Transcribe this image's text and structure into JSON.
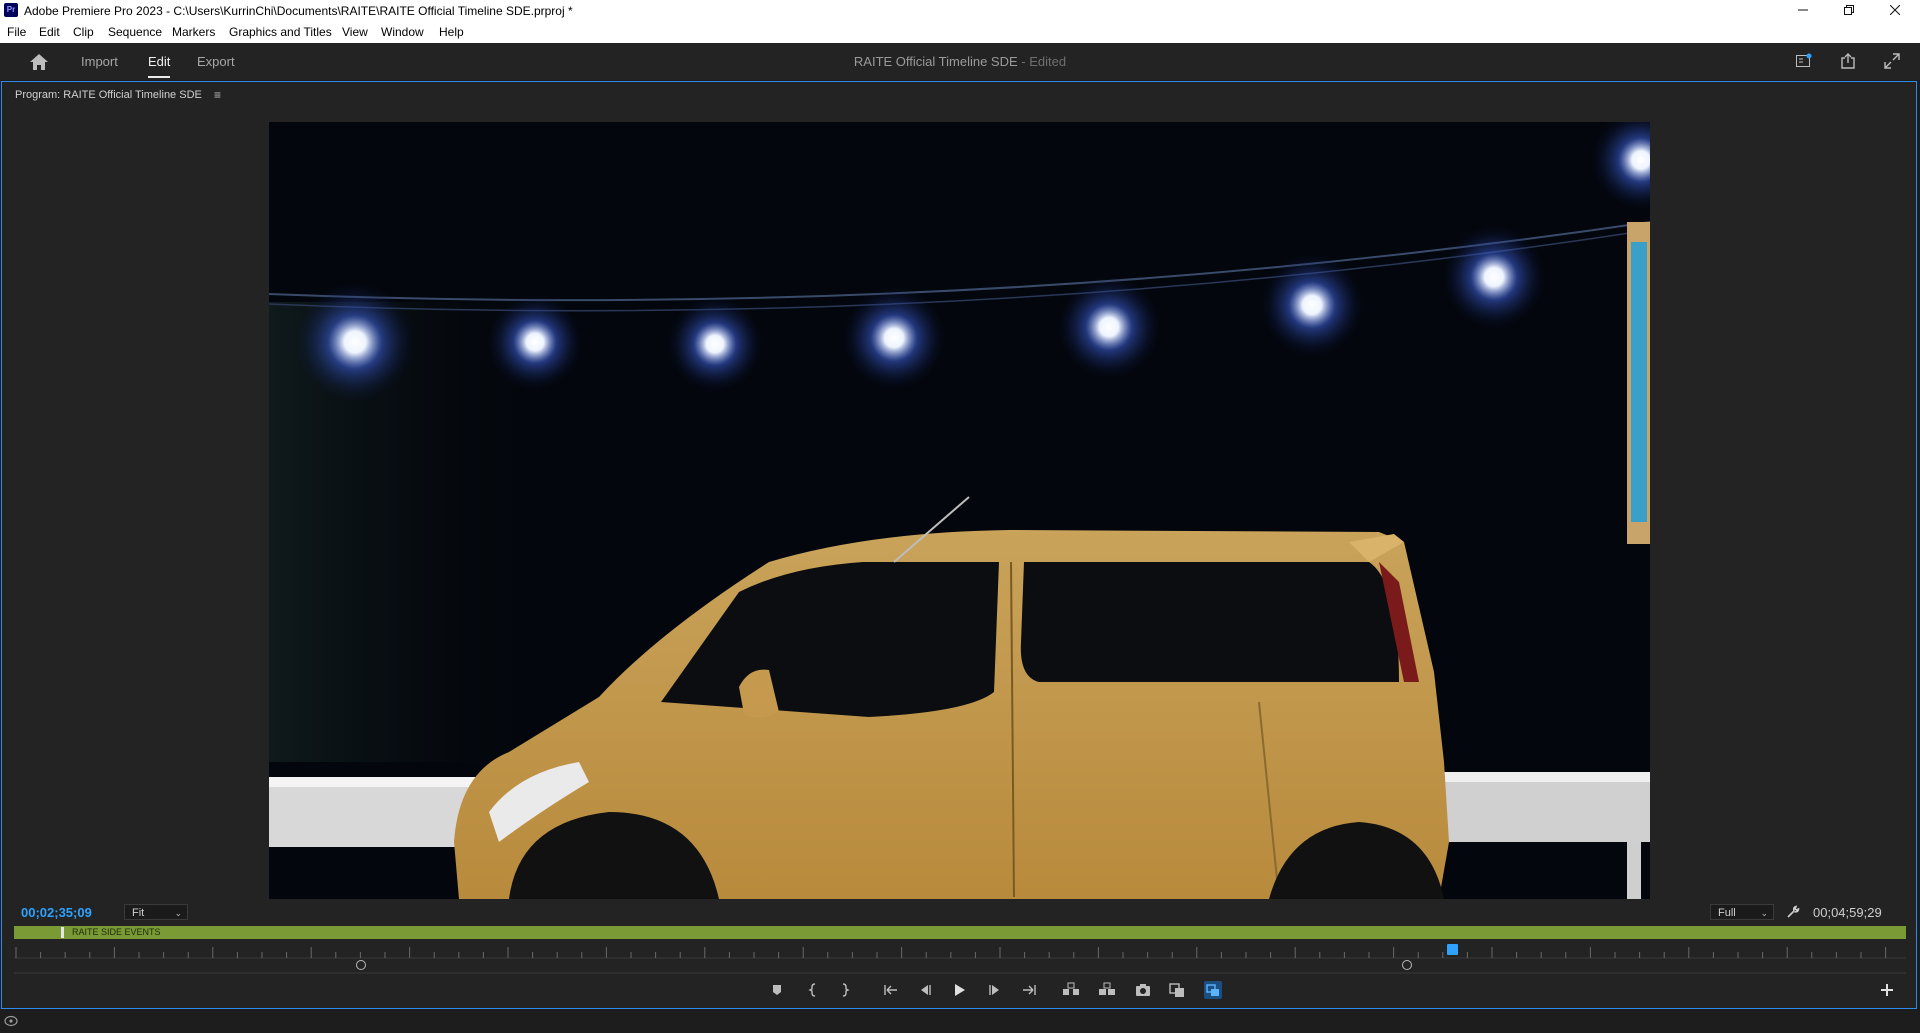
{
  "window": {
    "app_logo": "Pr",
    "title": "Adobe Premiere Pro 2023 - C:\\Users\\KurrinChi\\Documents\\RAITE\\RAITE Official Timeline SDE.prproj *",
    "controls": [
      "minimize-icon",
      "restore-icon",
      "close-icon"
    ]
  },
  "menu": {
    "items": [
      "File",
      "Edit",
      "Clip",
      "Sequence",
      "Markers",
      "Graphics and Titles",
      "View",
      "Window",
      "Help"
    ]
  },
  "header": {
    "tabs": [
      {
        "label": "Import",
        "active": false
      },
      {
        "label": "Edit",
        "active": true
      },
      {
        "label": "Export",
        "active": false
      }
    ],
    "project_title": "RAITE Official Timeline SDE",
    "project_status": " - Edited",
    "right_icons": [
      "quick-export-panel-icon",
      "share-icon",
      "fullscreen-icon"
    ]
  },
  "program_monitor": {
    "title": "Program: RAITE Official Timeline SDE",
    "menu_icon": "≡",
    "current_timecode": "00;02;35;09",
    "zoom_level": "Fit",
    "resolution": "Full",
    "duration": "00;04;59;29",
    "sequence_label": "RAITE SIDE EVENTS",
    "playhead_fraction": 0.76
  },
  "transport_controls": [
    {
      "name": "add-marker-icon"
    },
    {
      "name": "mark-in-icon"
    },
    {
      "name": "mark-out-icon"
    },
    {
      "name": "go-to-in-icon"
    },
    {
      "name": "step-back-icon"
    },
    {
      "name": "play-icon"
    },
    {
      "name": "step-forward-icon"
    },
    {
      "name": "go-to-out-icon"
    },
    {
      "name": "lift-icon"
    },
    {
      "name": "extract-icon"
    },
    {
      "name": "export-frame-icon"
    },
    {
      "name": "comparison-view-icon"
    },
    {
      "name": "proxy-toggle-icon"
    }
  ],
  "colors": {
    "accent": "#2fa1ff",
    "sequence_bar": "#7a9a36",
    "panel_bg": "#232323"
  }
}
